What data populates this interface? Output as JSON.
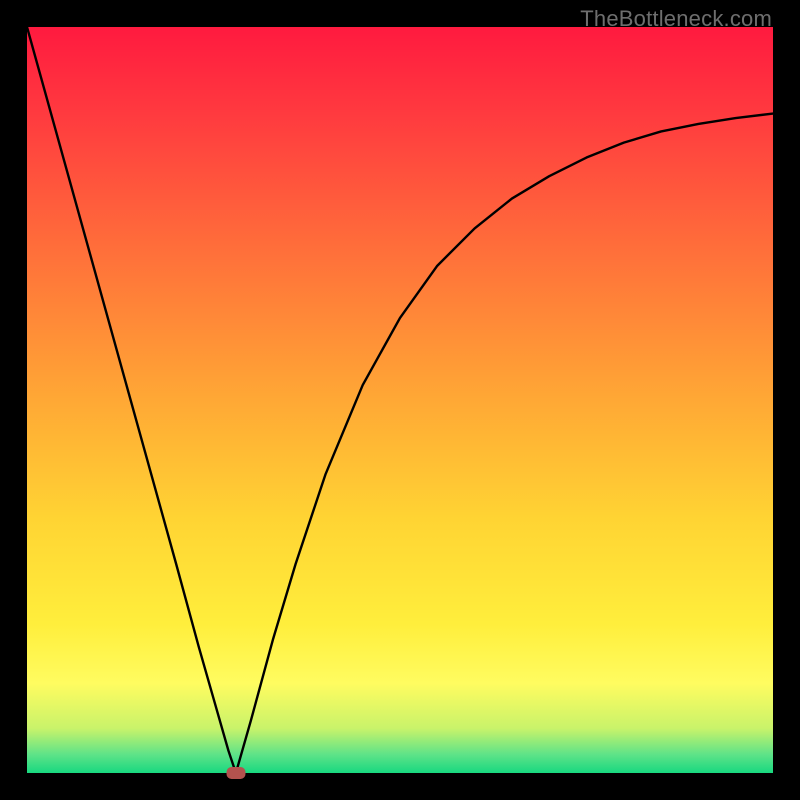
{
  "watermark": "TheBottleneck.com",
  "chart_data": {
    "type": "line",
    "title": "",
    "xlabel": "",
    "ylabel": "",
    "xlim": [
      0,
      100
    ],
    "ylim": [
      0,
      100
    ],
    "grid": false,
    "series": [
      {
        "name": "bottleneck-curve",
        "x": [
          0,
          5,
          10,
          15,
          20,
          23,
          25,
          27,
          28,
          30,
          33,
          36,
          40,
          45,
          50,
          55,
          60,
          65,
          70,
          75,
          80,
          85,
          90,
          95,
          100
        ],
        "y": [
          100,
          82,
          64,
          46,
          28,
          17,
          10,
          3,
          0,
          7,
          18,
          28,
          40,
          52,
          61,
          68,
          73,
          77,
          80,
          82.5,
          84.5,
          86,
          87,
          87.8,
          88.4
        ]
      }
    ],
    "gradient_stops": [
      {
        "pos": 0.0,
        "color": "#ff1a3f"
      },
      {
        "pos": 0.12,
        "color": "#ff3b3f"
      },
      {
        "pos": 0.3,
        "color": "#ff6f3a"
      },
      {
        "pos": 0.5,
        "color": "#ffa835"
      },
      {
        "pos": 0.66,
        "color": "#ffd433"
      },
      {
        "pos": 0.8,
        "color": "#ffee3c"
      },
      {
        "pos": 0.88,
        "color": "#fffc60"
      },
      {
        "pos": 0.94,
        "color": "#c9f36a"
      },
      {
        "pos": 0.975,
        "color": "#5fe388"
      },
      {
        "pos": 1.0,
        "color": "#18d880"
      }
    ],
    "marker": {
      "x": 28,
      "y": 0,
      "color": "#b3524e"
    }
  }
}
